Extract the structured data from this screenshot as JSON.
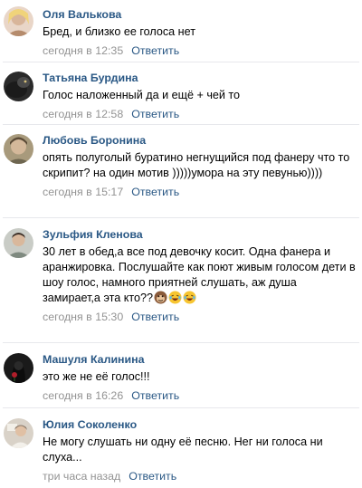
{
  "comments": [
    {
      "author": "Оля Валькова",
      "text": "Бред, и близко ее голоса нет",
      "timestamp": "сегодня в 12:35",
      "reply_label": "Ответить",
      "avatar_colors": [
        "#e9d6c8",
        "#b58b6c"
      ]
    },
    {
      "author": "Татьяна Бурдина",
      "text": "Голос наложенный да и ещё + чей то",
      "timestamp": "сегодня в 12:58",
      "reply_label": "Ответить",
      "avatar_colors": [
        "#3a3a3a",
        "#1b1b1b"
      ]
    },
    {
      "author": "Любовь Боронина",
      "text": "опять полуголый буратино негнущийся под фанеру что то скрипит? на один мотив )))))умора на эту певунью))))",
      "timestamp": "сегодня в 15:17",
      "reply_label": "Ответить",
      "avatar_colors": [
        "#a89a7c",
        "#6e6650"
      ]
    },
    {
      "author": "Зульфия Кленова",
      "text": "30 лет в обед,а все под девочку косит. Одна фанера и аранжировка. Послушайте как поют живым голосом дети в шоу голос, намного приятней слушать, аж душа замирает,а эта кто??",
      "timestamp": "сегодня в 15:30",
      "reply_label": "Ответить",
      "avatar_colors": [
        "#c9ccc6",
        "#7f8a80"
      ],
      "emojis": [
        "monkey-face",
        "laughing-face",
        "laughing-face"
      ]
    },
    {
      "author": "Машуля Калинина",
      "text": "это же не её голос!!!",
      "timestamp": "сегодня в 16:26",
      "reply_label": "Ответить",
      "avatar_colors": [
        "#1a1a1a",
        "#b01e2a"
      ]
    },
    {
      "author": "Юлия Соколенко",
      "text": "Не могу слушать ни одну её песню. Нег ни голоса ни слуха...",
      "timestamp": "три часа назад",
      "reply_label": "Ответить",
      "avatar_colors": [
        "#d9d2c8",
        "#8c7a6a"
      ]
    }
  ]
}
